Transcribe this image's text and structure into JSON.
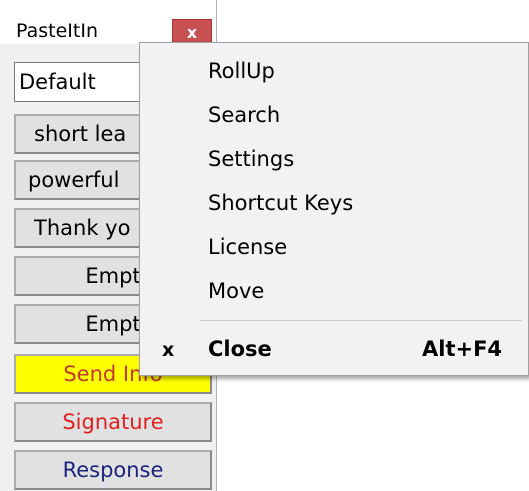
{
  "window": {
    "title": "PasteItIn",
    "close_glyph": "x",
    "preset": "Default"
  },
  "snippets": [
    {
      "label": "short lea"
    },
    {
      "label": "powerful"
    },
    {
      "label": "Thank yo"
    },
    {
      "label": "Empt"
    },
    {
      "label": "Empt"
    },
    {
      "label": "Send Info",
      "color": "#c0392b",
      "background": "#ffff00"
    },
    {
      "label": "Signature",
      "color": "#e02020"
    },
    {
      "label": "Response",
      "color": "#1a237e"
    }
  ],
  "context_menu": {
    "items": [
      {
        "label": "RollUp"
      },
      {
        "label": "Search"
      },
      {
        "label": "Settings"
      },
      {
        "label": "Shortcut Keys"
      },
      {
        "label": "License"
      },
      {
        "label": "Move"
      }
    ],
    "close": {
      "icon_glyph": "x",
      "label": "Close",
      "shortcut": "Alt+F4"
    }
  }
}
